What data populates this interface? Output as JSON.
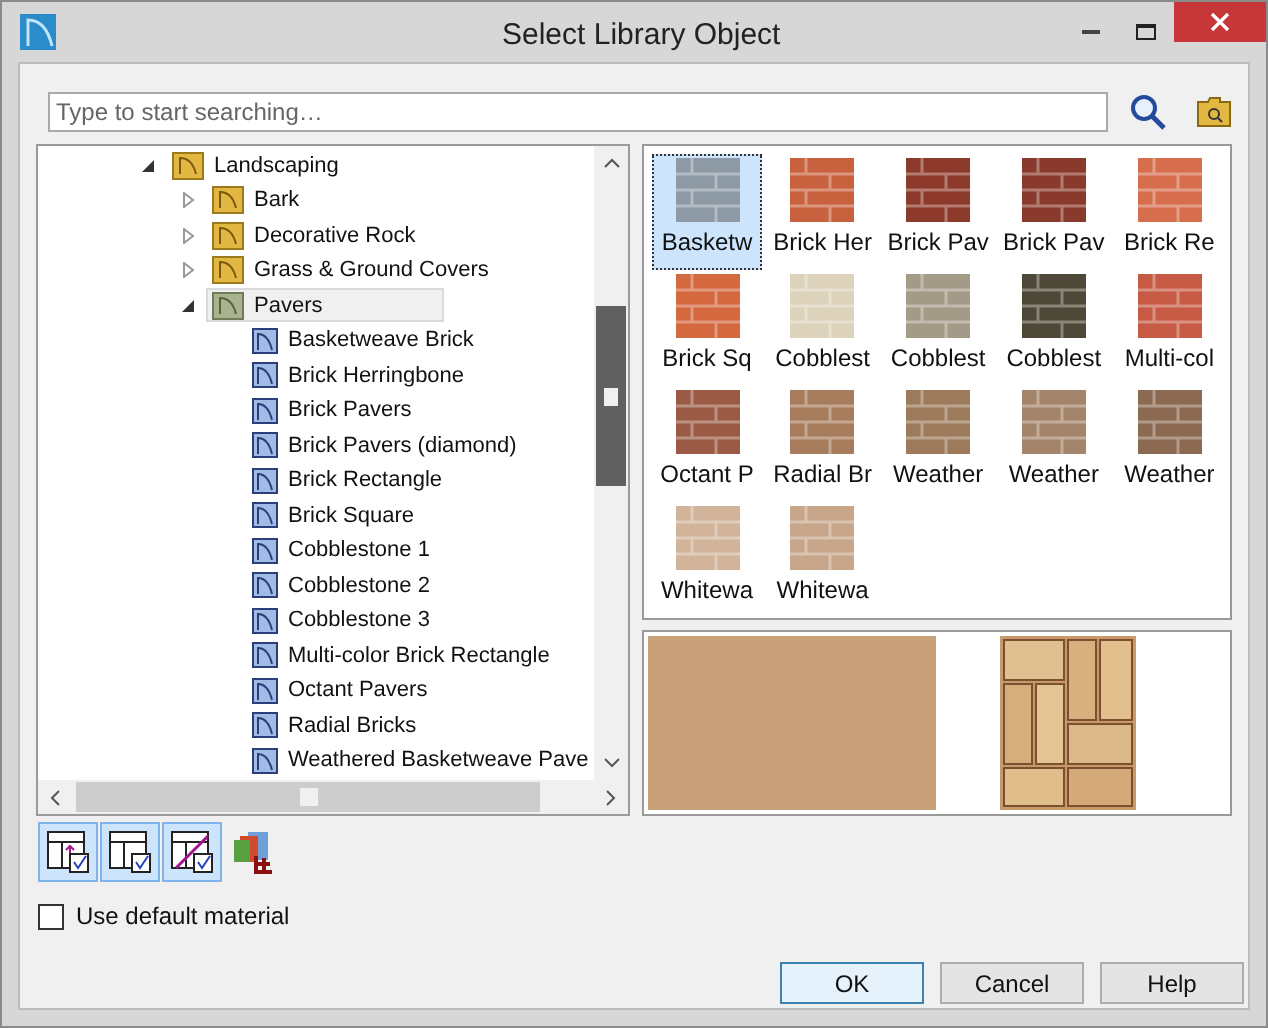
{
  "window": {
    "title": "Select Library Object"
  },
  "search": {
    "placeholder": "Type to start searching…"
  },
  "tree": [
    {
      "label": "Landscaping",
      "kind": "folder",
      "expanded": true,
      "selected": false,
      "children": [
        {
          "label": "Bark",
          "kind": "folder",
          "expanded": false,
          "selected": false
        },
        {
          "label": "Decorative Rock",
          "kind": "folder",
          "expanded": false,
          "selected": false
        },
        {
          "label": "Grass & Ground Covers",
          "kind": "folder",
          "expanded": false,
          "selected": false
        },
        {
          "label": "Pavers",
          "kind": "folder",
          "expanded": true,
          "selected": true,
          "children": [
            {
              "label": "Basketweave Brick",
              "kind": "item",
              "selected": false
            },
            {
              "label": "Brick Herringbone",
              "kind": "item",
              "selected": false
            },
            {
              "label": "Brick Pavers",
              "kind": "item",
              "selected": false
            },
            {
              "label": "Brick Pavers (diamond)",
              "kind": "item",
              "selected": false
            },
            {
              "label": "Brick Rectangle",
              "kind": "item",
              "selected": false
            },
            {
              "label": "Brick Square",
              "kind": "item",
              "selected": false
            },
            {
              "label": "Cobblestone 1",
              "kind": "item",
              "selected": false
            },
            {
              "label": "Cobblestone 2",
              "kind": "item",
              "selected": false
            },
            {
              "label": "Cobblestone 3",
              "kind": "item",
              "selected": false
            },
            {
              "label": "Multi-color Brick Rectangle",
              "kind": "item",
              "selected": false
            },
            {
              "label": "Octant Pavers",
              "kind": "item",
              "selected": false
            },
            {
              "label": "Radial Bricks",
              "kind": "item",
              "selected": false
            },
            {
              "label": "Weathered Basketweave Pave",
              "kind": "item",
              "selected": false
            }
          ]
        }
      ]
    }
  ],
  "thumbnails": [
    {
      "label": "Basketw",
      "color": "#8e9aa6",
      "selected": true
    },
    {
      "label": "Brick Her",
      "color": "#c8623e",
      "selected": false
    },
    {
      "label": "Brick Pav",
      "color": "#8e3a2a",
      "selected": false
    },
    {
      "label": "Brick Pav",
      "color": "#8a3a2c",
      "selected": false
    },
    {
      "label": "Brick Re",
      "color": "#d66e4e",
      "selected": false
    },
    {
      "label": "Brick Sq",
      "color": "#d4683e",
      "selected": false
    },
    {
      "label": "Cobblest",
      "color": "#ddd2bc",
      "selected": false
    },
    {
      "label": "Cobblest",
      "color": "#a49a88",
      "selected": false
    },
    {
      "label": "Cobblest",
      "color": "#4e4838",
      "selected": false
    },
    {
      "label": "Multi-col",
      "color": "#c65a44",
      "selected": false
    },
    {
      "label": "Octant P",
      "color": "#9a5a44",
      "selected": false
    },
    {
      "label": "Radial Br",
      "color": "#a67c5c",
      "selected": false
    },
    {
      "label": "Weather",
      "color": "#9c7a5a",
      "selected": false
    },
    {
      "label": "Weather",
      "color": "#a4846a",
      "selected": false
    },
    {
      "label": "Weather",
      "color": "#8c6a52",
      "selected": false
    },
    {
      "label": "Whitewa",
      "color": "#d2b49a",
      "selected": false
    },
    {
      "label": "Whitewa",
      "color": "#c8a68a",
      "selected": false
    }
  ],
  "preview": {
    "color": "#c8a07a"
  },
  "toolbar": [
    {
      "kind": "filter-up",
      "selected": true
    },
    {
      "kind": "filter",
      "selected": true
    },
    {
      "kind": "filter-material",
      "selected": true
    },
    {
      "kind": "add-material",
      "selected": false
    }
  ],
  "use_default_material": {
    "label": "Use default material",
    "checked": false
  },
  "buttons": [
    {
      "label": "OK",
      "default": true
    },
    {
      "label": "Cancel",
      "default": false
    },
    {
      "label": "Help",
      "default": false
    }
  ]
}
